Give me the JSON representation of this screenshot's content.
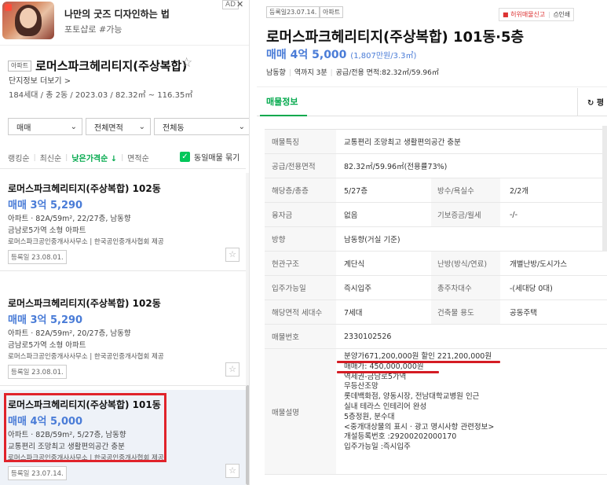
{
  "ad": {
    "title": "나만의 굿즈 디자인하는 법",
    "subtitle": "포토샵로 #가능",
    "badge": "AD",
    "close": "✕"
  },
  "complex": {
    "tag": "아파트",
    "name": "로머스파크헤리티지(주상복합)",
    "star": "☆",
    "more_info": "단지정보 더보기 >",
    "info": "184세대 / 총 2동 / 2023.03 / 82.32㎡ ~ 116.35㎡"
  },
  "filters": [
    {
      "label": "매매",
      "width": 95
    },
    {
      "label": "전체면적",
      "width": 83
    },
    {
      "label": "전체동",
      "width": 123
    }
  ],
  "sorts": {
    "items": [
      "랭킹순",
      "최신순",
      "낮은가격순 ↓",
      "면적순"
    ],
    "active_index": 2,
    "same_listing_label": "동일매물 묶기",
    "same_listing_checked": true
  },
  "listings": [
    {
      "title": "로머스파크헤리티지(주상복합) 102동",
      "price": "매매 3억 5,290",
      "spec": "아파트 · 82A/59m², 22/27층, 남동향",
      "desc": "금남로5가역 소형 아파트",
      "agent": "로머스파크공인중개사사무소 | 한국공인중개사협회 제공",
      "date": "등록일 23.08.01.",
      "selected": false
    },
    {
      "title": "로머스파크헤리티지(주상복합) 102동",
      "price": "매매 3억 5,290",
      "spec": "아파트 · 82A/59m², 20/27층, 남동향",
      "desc": "금남로5가역 소형 아파트",
      "agent": "로머스파크공인중개사사무소 | 한국공인중개사협회 제공",
      "date": "등록일 23.08.01.",
      "selected": false
    },
    {
      "title": "로머스파크헤리티지(주상복합) 101동",
      "price": "매매 4억 5,000",
      "spec": "아파트 · 82B/59m², 5/27층, 남동향",
      "desc": "교통편리 조망최고 생활편의공간 충분",
      "agent": "로머스파크공인중개사사무소 | 한국공인중개사협회 제공",
      "date": "등록일 23.07.14.",
      "selected": true
    }
  ],
  "detail": {
    "date": "등록일23.07.14.",
    "tag": "아파트",
    "report": "허위매물신고",
    "print": "인쇄",
    "title": "로머스파크헤리티지(주상복합) 101동·5층",
    "price": "매매 4억 5,000",
    "price_unit": "(1,807만원/3.3㎡)",
    "meta": [
      "남동향",
      "역까지 3분",
      "공급/전용 면적:82.32㎡/59.96㎡"
    ],
    "tab": "매물정보",
    "compare": "평"
  },
  "table": [
    {
      "k": "매물특징",
      "v": "교통편리 조망최고 생활편의공간 충분"
    },
    {
      "k": "공급/전용면적",
      "v": "82.32㎡/59.96㎡(전용률73%)"
    },
    {
      "k": "해당층/총층",
      "v": "5/27층",
      "k2": "방수/욕실수",
      "v2": "2/2개"
    },
    {
      "k": "융자금",
      "v": "없음",
      "k2": "기보증금/월세",
      "v2": "-/-"
    },
    {
      "k": "방향",
      "v": "남동향(거실 기준)"
    },
    {
      "k": "현관구조",
      "v": "계단식",
      "k2": "난방(방식/연료)",
      "v2": "개별난방/도시가스"
    },
    {
      "k": "입주가능일",
      "v": "즉시입주",
      "k2": "총주차대수",
      "v2": "-(세대당 0대)"
    },
    {
      "k": "해당면적 세대수",
      "v": "7세대",
      "k2": "건축물 용도",
      "v2": "공동주택"
    },
    {
      "k": "매물번호",
      "v": "2330102526"
    }
  ],
  "description": {
    "label": "매물설명",
    "lines": [
      "분양가671,200,000원 할인 221,200,000원",
      "매매가: 450,000,000원",
      "역세권-금남로5가역",
      "무등산조망",
      "롯데백화점, 양동시장, 전남대학교병원 인근",
      "실내 테라스 인테리어 완성",
      "5층정원, 분수대",
      "<중개대상물의 표시 · 광고 명시사항 관련정보>",
      "개설등록번호 :29200202000170",
      "입주가능일 :즉시입주"
    ]
  },
  "colors": {
    "accent_green": "#03c75a",
    "price_blue": "#4a7cd7",
    "highlight_red": "#e0232b"
  }
}
